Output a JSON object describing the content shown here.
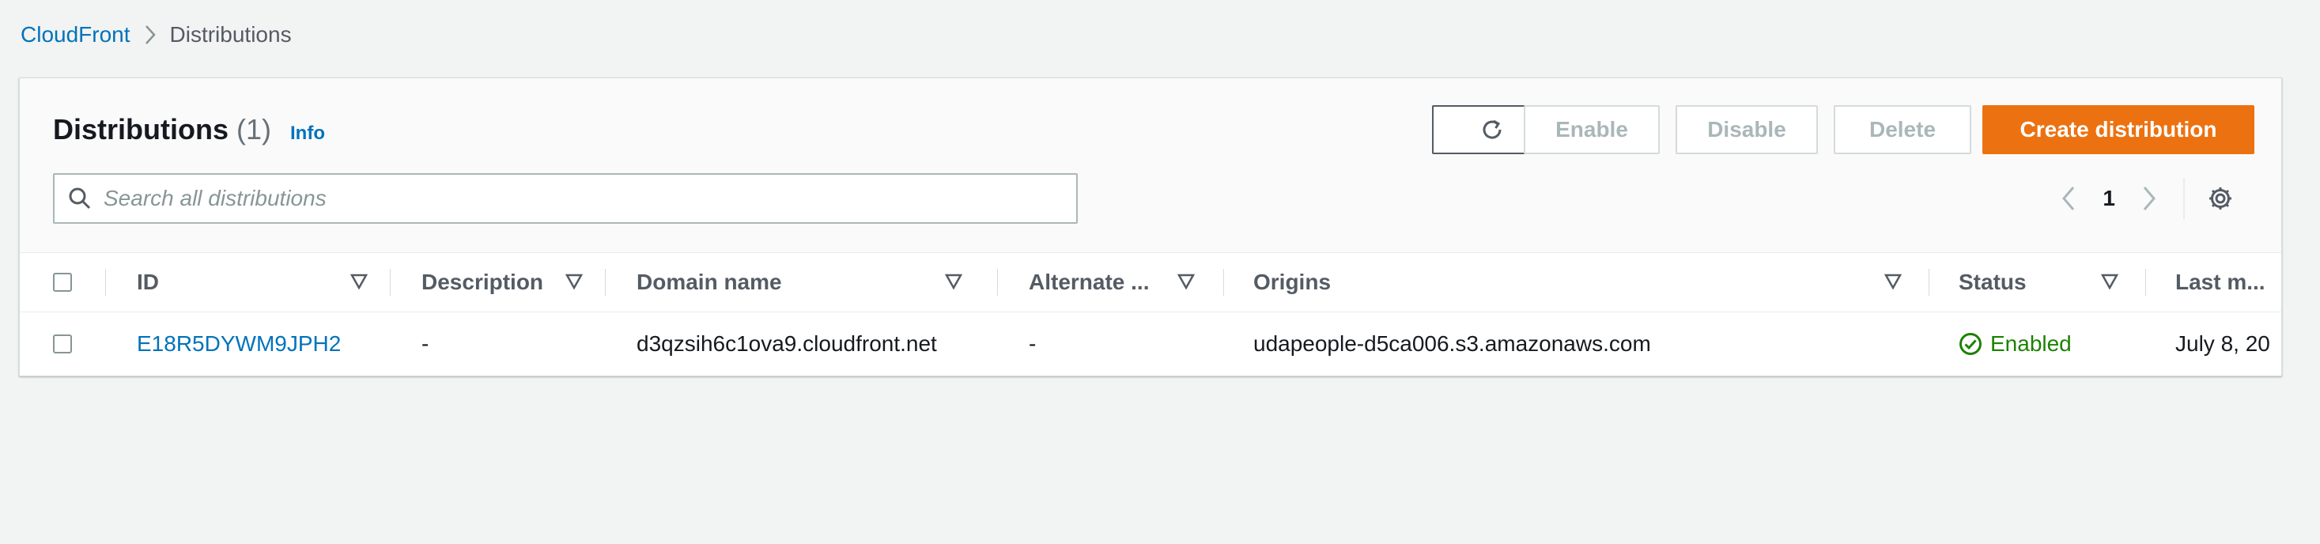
{
  "breadcrumb": {
    "root": "CloudFront",
    "current": "Distributions"
  },
  "panel": {
    "title": "Distributions",
    "count": "(1)",
    "info": "Info"
  },
  "actions": {
    "enable": "Enable",
    "disable": "Disable",
    "delete": "Delete",
    "create": "Create distribution"
  },
  "search": {
    "placeholder": "Search all distributions"
  },
  "pagination": {
    "current_page": "1"
  },
  "table": {
    "headers": {
      "id": "ID",
      "description": "Description",
      "domain": "Domain name",
      "alternate": "Alternate ...",
      "origins": "Origins",
      "status": "Status",
      "last_modified": "Last m..."
    },
    "rows": [
      {
        "id": "E18R5DYWM9JPH2",
        "description": "-",
        "domain": "d3qzsih6c1ova9.cloudfront.net",
        "alternate": "-",
        "origins": "udapeople-d5ca006.s3.amazonaws.com",
        "status": "Enabled",
        "last_modified": "July 8, 20"
      }
    ]
  },
  "colors": {
    "primary_button": "#ec7211",
    "link": "#0073bb",
    "status_enabled": "#1d8102",
    "background": "#f2f3f3"
  },
  "icons": [
    "chevron-right-icon",
    "refresh-icon",
    "search-icon",
    "chevron-left-icon",
    "gear-icon",
    "sort-down-icon",
    "status-check-icon"
  ]
}
